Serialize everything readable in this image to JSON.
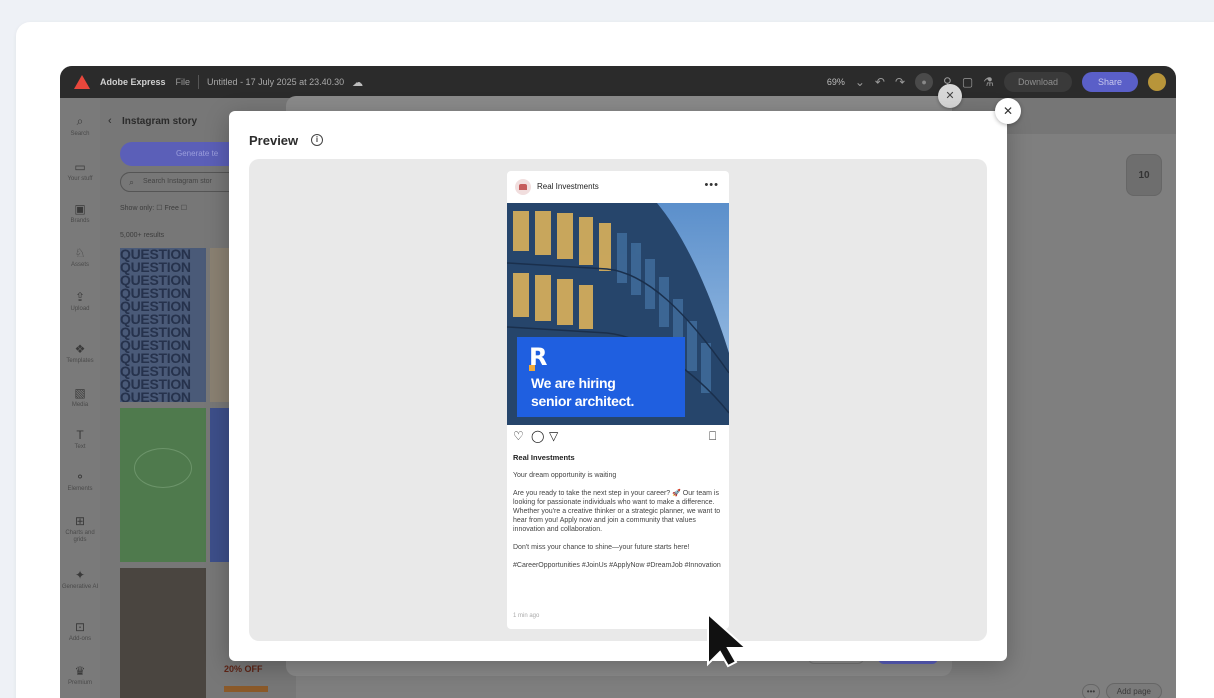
{
  "app": {
    "name": "Adobe Express",
    "file_menu": "File",
    "doc_title": "Untitled - 17 July 2025 at 23.40.30",
    "zoom": "69%",
    "download": "Download",
    "share": "Share"
  },
  "rail": [
    {
      "label": "Search",
      "icon": "search-icon"
    },
    {
      "label": "Your stuff",
      "icon": "folder-icon"
    },
    {
      "label": "Brands",
      "icon": "brand-icon"
    },
    {
      "label": "Assets",
      "icon": "assets-icon"
    },
    {
      "label": "Upload",
      "icon": "upload-icon"
    },
    {
      "label": "Templates",
      "icon": "templates-icon"
    },
    {
      "label": "Media",
      "icon": "media-icon"
    },
    {
      "label": "Text",
      "icon": "text-icon"
    },
    {
      "label": "Elements",
      "icon": "elements-icon"
    },
    {
      "label": "Charts and grids",
      "icon": "charts-icon"
    },
    {
      "label": "Generative AI",
      "icon": "ai-icon"
    },
    {
      "label": "Add-ons",
      "icon": "addons-icon"
    },
    {
      "label": "Premium",
      "icon": "premium-icon"
    }
  ],
  "panel": {
    "title": "Instagram story",
    "generate": "Generate te",
    "search_placeholder": "Search Instagram stor",
    "show_only": "Show only:",
    "free": "Free",
    "results": "5,000+ results",
    "question_word": "QUESTION",
    "sale_text": "20% OFF"
  },
  "canvas": {
    "page_count": "10",
    "add_page": "Add page"
  },
  "modal": {
    "title": "Preview"
  },
  "post": {
    "username": "Real Investments",
    "headline_line1": "We are hiring",
    "headline_line2": "senior architect.",
    "brand_letter": "R",
    "caption_title": "Your dream opportunity is waiting",
    "caption_body": "Are you ready to take the next step in your career? 🚀 Our team is looking for passionate individuals who want to make a difference. Whether you're a creative thinker or a strategic planner, we want to hear from you! Apply now and join a community that values innovation and collaboration.",
    "caption_cta": "Don't miss your chance to shine—your future starts here!",
    "hashtags": "#CareerOpportunities #JoinUs #ApplyNow #DreamJob #Innovation",
    "time": "1 min ago"
  },
  "colors": {
    "accent": "#1f5fe0",
    "brand_orange": "#f0a93a",
    "share_purple": "#5a5fc8"
  }
}
